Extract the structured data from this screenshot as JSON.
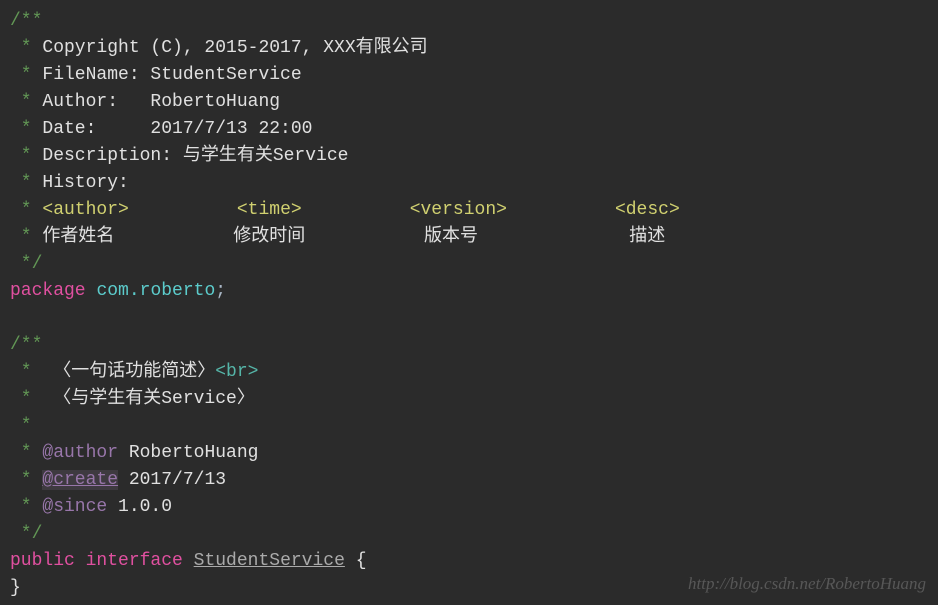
{
  "line1": "/**",
  "line2_prefix": " * ",
  "line2_text": "Copyright (C), 2015-2017, XXX有限公司",
  "line3_prefix": " * ",
  "line3_text": "FileName: StudentService",
  "line4_prefix": " * ",
  "line4_text": "Author:   RobertoHuang",
  "line5_prefix": " * ",
  "line5_text": "Date:     2017/7/13 22:00",
  "line6_prefix": " * ",
  "line6_text": "Description: 与学生有关Service",
  "line7_prefix": " * ",
  "line7_text": "History:",
  "line8_prefix": " * ",
  "line8_author": "<author>",
  "line8_time": "<time>",
  "line8_version": "<version>",
  "line8_desc": "<desc>",
  "line8_sp1": "          ",
  "line8_sp2": "          ",
  "line8_sp3": "          ",
  "line9_prefix": " * ",
  "line9_text": "作者姓名           修改时间           版本号              描述",
  "line10": " */",
  "line11_kw": "package",
  "line11_sp": " ",
  "line11_pkg": "com.roberto",
  "line11_semi": ";",
  "line12": "",
  "line13": "/**",
  "line14_prefix": " *  ",
  "line14_text": "〈一句话功能简述〉",
  "line14_br": "<br>",
  "line15_prefix": " *  ",
  "line15_text": "〈与学生有关Service〉",
  "line16": " *",
  "line17_prefix": " * ",
  "line17_tag": "@author",
  "line17_val": " RobertoHuang",
  "line18_prefix": " * ",
  "line18_tag": "@create",
  "line18_val": " 2017/7/13",
  "line19_prefix": " * ",
  "line19_tag": "@since",
  "line19_val": " 1.0.0",
  "line20": " */",
  "line21_kw1": "public",
  "line21_kw2": "interface",
  "line21_sp1": " ",
  "line21_sp2": " ",
  "line21_name": "StudentService",
  "line21_sp3": " ",
  "line21_brace": "{",
  "line22": "}",
  "watermark": "http://blog.csdn.net/RobertoHuang"
}
